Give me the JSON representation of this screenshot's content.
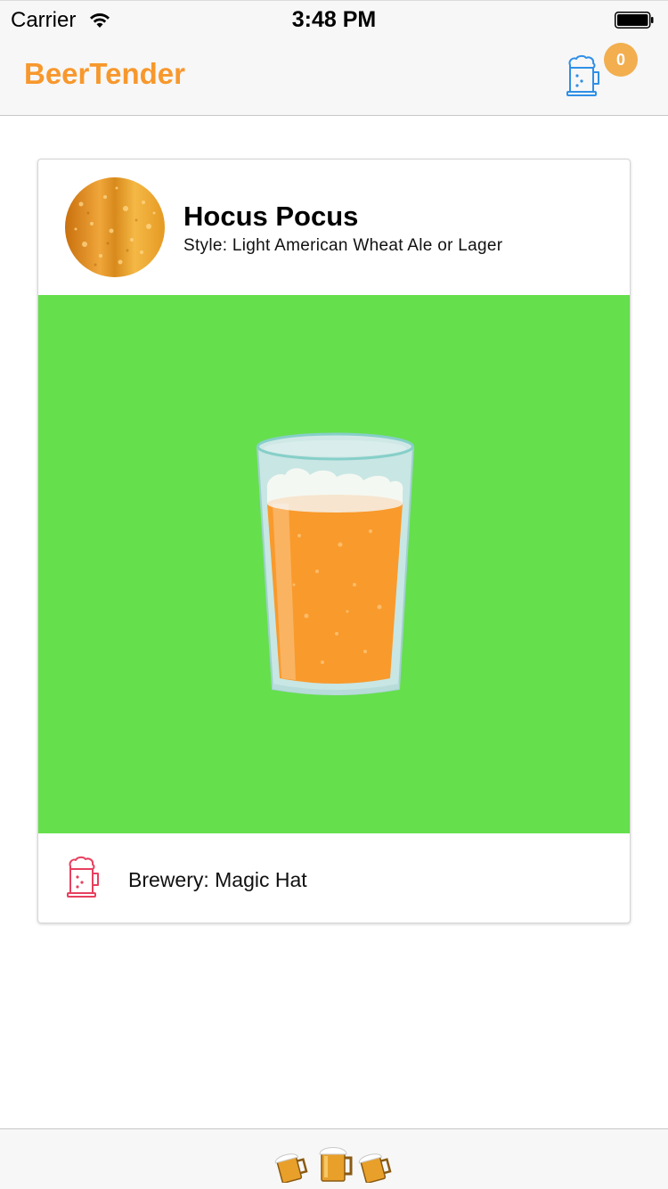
{
  "status_bar": {
    "carrier": "Carrier",
    "time": "3:48 PM"
  },
  "nav": {
    "title": "BeerTender",
    "cart_icon": "beer-mug-icon",
    "cart_count": "0"
  },
  "beer": {
    "name": "Hocus Pocus",
    "style": "Style: Light American Wheat Ale or Lager",
    "brewery": "Brewery: Magic Hat",
    "avatar_icon": "beer-foam-texture",
    "image_icon": "pint-glass-icon",
    "image_background": "#66df4c",
    "brewery_icon": "beer-mug-icon"
  },
  "tab_bar": {
    "icon": "clinking-beer-mugs-icon"
  },
  "colors": {
    "accent": "#f7982d",
    "badge": "#f2ae4f",
    "cart_icon": "#2f8fe6",
    "brewery_icon": "#e8405f",
    "beer": "#f99a2c"
  }
}
